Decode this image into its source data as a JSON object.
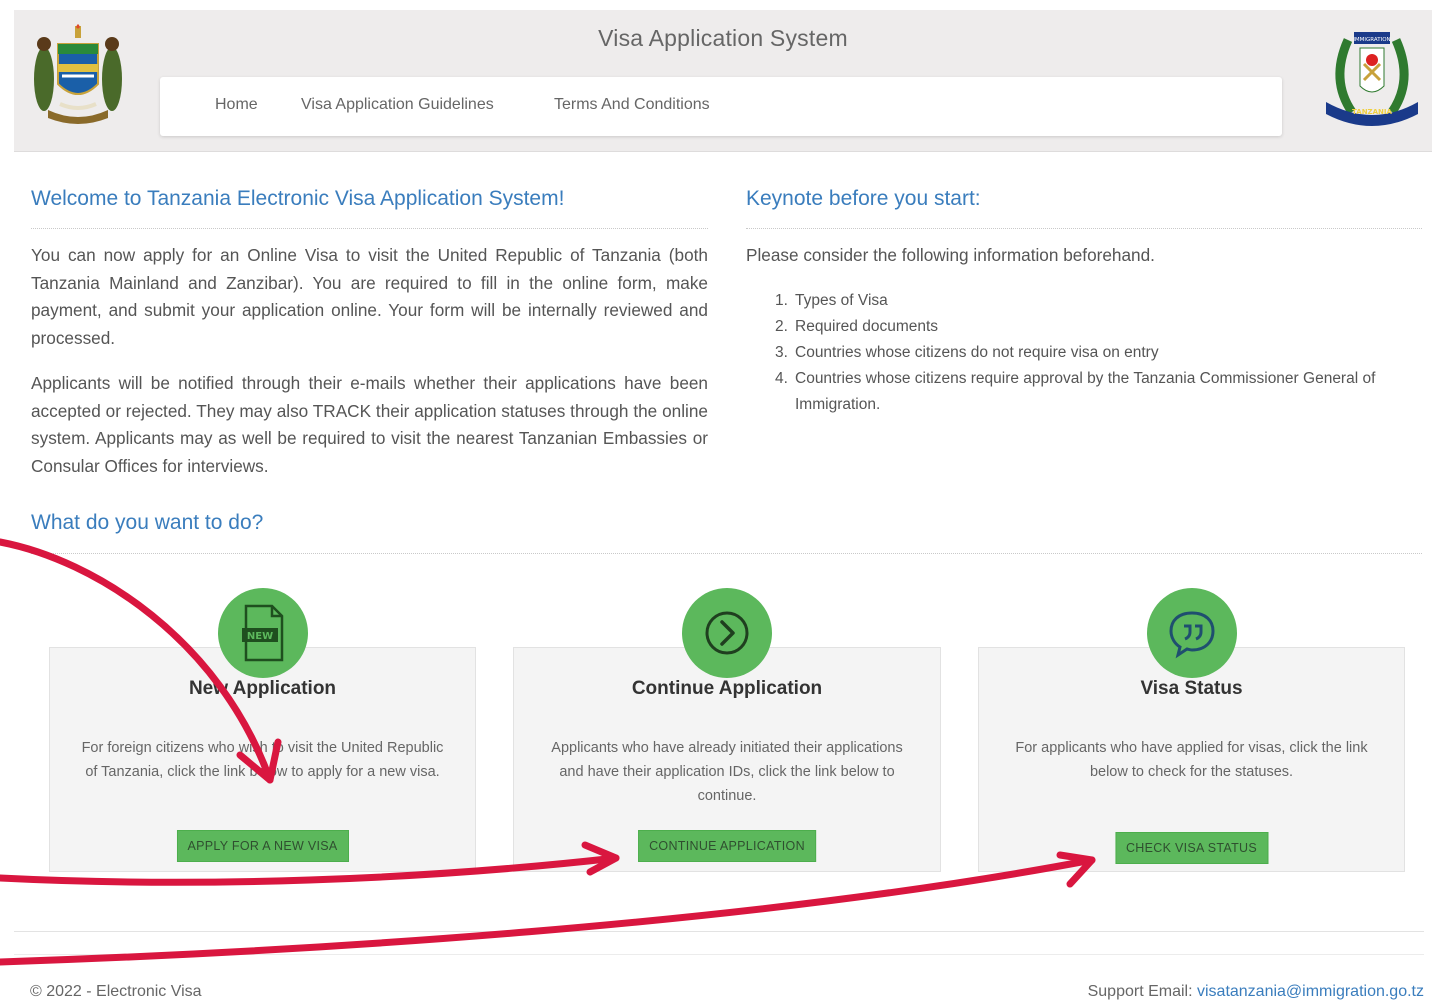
{
  "header": {
    "title": "Visa Application System",
    "nav": [
      "Home",
      "Visa Application Guidelines",
      "Terms And Conditions"
    ],
    "logo_right_text": "TANZANIA",
    "logo_right_top": "IMMIGRATION"
  },
  "welcome": {
    "title": "Welcome to Tanzania Electronic Visa Application System!",
    "para1": "You can now apply for an Online Visa to visit the United Republic of Tanzania (both Tanzania Mainland and Zanzibar). You are required to fill in the online form, make payment, and submit your application online. Your form will be internally reviewed and processed.",
    "para2": "Applicants will be notified through their e-mails whether their applications have been accepted or rejected. They may also TRACK their application statuses through the online system. Applicants may as well be required to visit the nearest Tanzanian Embassies or Consular Offices for interviews."
  },
  "keynote": {
    "title": "Keynote before you start:",
    "intro": "Please consider the following information beforehand.",
    "items": [
      "Types of Visa",
      "Required documents",
      "Countries whose citizens do not require visa on entry",
      "Countries whose citizens require approval by the Tanzania Commissioner General of Immigration."
    ]
  },
  "actions": {
    "title": "What do you want to do?",
    "cards": [
      {
        "icon": "new-document-icon",
        "icon_text": "NEW",
        "title": "New Application",
        "text": "For foreign citizens who wish to visit the United Republic of Tanzania, click the link below to apply for a new visa.",
        "button": "APPLY FOR A NEW VISA"
      },
      {
        "icon": "chevron-circle-right-icon",
        "title": "Continue Application",
        "text": "Applicants who have already initiated their applications and have their application IDs, click the link below to continue.",
        "button": "CONTINUE APPLICATION"
      },
      {
        "icon": "quote-bubble-icon",
        "title": "Visa Status",
        "text": "For applicants who have applied for visas, click the link below to check for the statuses.",
        "button": "CHECK VISA STATUS"
      }
    ]
  },
  "footer": {
    "copyright": "© 2022 - Electronic Visa",
    "support_label": "Support Email: ",
    "support_email": "visatanzania@immigration.go.tz"
  },
  "colors": {
    "accent_green": "#5cb85c",
    "title_blue": "#3a7dbd",
    "annotation_red": "#d9163f"
  }
}
